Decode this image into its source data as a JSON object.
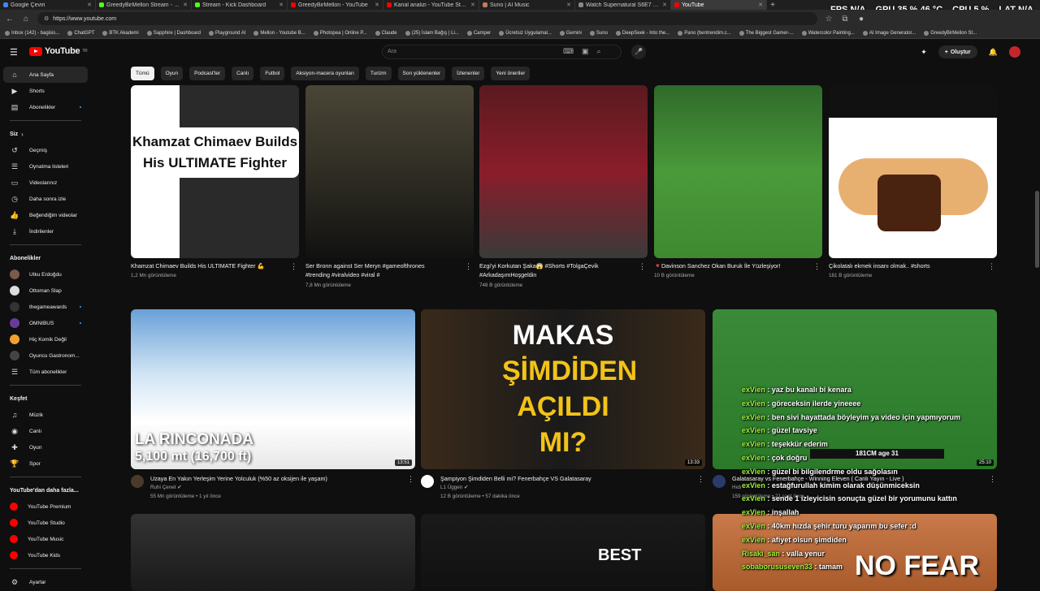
{
  "tabs": [
    {
      "label": "Google Çeviri",
      "color": "#4285f4"
    },
    {
      "label": "GreedyBirMellon Stream - Watch",
      "color": "#53fc18"
    },
    {
      "label": "Stream - Kick Dashboard",
      "color": "#53fc18"
    },
    {
      "label": "GreedyBirMellon - YouTube",
      "color": "#ff0000"
    },
    {
      "label": "Kanal analizi - YouTube Studio",
      "color": "#ff0000"
    },
    {
      "label": "Suno | AI Music",
      "color": "#c47a5a"
    },
    {
      "label": "Watch Supernatural S6E7 online",
      "color": "#888888"
    },
    {
      "label": "YouTube",
      "color": "#ff0000"
    }
  ],
  "overlay": {
    "fps_label": "FPS",
    "fps_value": "N/A",
    "gpu_label": "GPU",
    "gpu_value": "35 % 46 °C",
    "cpu_label": "CPU",
    "cpu_value": "5 %",
    "lat_label": "LAT",
    "lat_value": "N/A"
  },
  "address": {
    "url": "https://www.youtube.com"
  },
  "bookmarks": [
    "Inbox (142) - bagisis...",
    "ChatGPT",
    "BTK Akademi",
    "Sapphire | Dashboard",
    "Playground AI",
    "Mellon - Youtube B...",
    "Photopea | Online P...",
    "Claude",
    "(25) İslam Bağış | Li...",
    "Camper",
    "Ücretsiz Uygulamal...",
    "Gemini",
    "Suno",
    "DeepSeek - Into the...",
    "Pano (bentrendim.c...",
    "The Biggest Gamer-...",
    "Watercolor Painting...",
    "AI Image Generator...",
    "GreedyBirMellon St..."
  ],
  "header": {
    "logo": "YouTube",
    "logo_region": "TR",
    "search_placeholder": "Ara",
    "create_label": "Oluştur"
  },
  "sidebar": {
    "main": [
      {
        "label": "Ana Sayfa",
        "icon": "home-icon"
      },
      {
        "label": "Shorts",
        "icon": "shorts-icon"
      },
      {
        "label": "Abonelikler",
        "icon": "subscriptions-icon"
      }
    ],
    "you_title": "Siz",
    "you": [
      {
        "label": "Geçmiş",
        "icon": "history-icon"
      },
      {
        "label": "Oynatma listeleri",
        "icon": "playlist-icon"
      },
      {
        "label": "Videolarınız",
        "icon": "video-icon"
      },
      {
        "label": "Daha sonra izle",
        "icon": "clock-icon"
      },
      {
        "label": "Beğendiğim videolar",
        "icon": "like-icon"
      },
      {
        "label": "İndirilenler",
        "icon": "download-icon"
      }
    ],
    "subs_title": "Abonelikler",
    "subs": [
      {
        "label": "Utku Erdoğdu",
        "color": "#7a5a4a"
      },
      {
        "label": "Ottoman Slap",
        "color": "#dddddd"
      },
      {
        "label": "thegameawards",
        "color": "#333333"
      },
      {
        "label": "OMNIBUS",
        "color": "#6a3a9a"
      },
      {
        "label": "Hiç Komik Değil",
        "color": "#f0a030"
      },
      {
        "label": "Oyuncu Gastronom...",
        "color": "#444444"
      },
      {
        "label": "Tüm abonelikler",
        "color": ""
      }
    ],
    "explore_title": "Keşfet",
    "explore": [
      {
        "label": "Müzik",
        "icon": "music-icon"
      },
      {
        "label": "Canlı",
        "icon": "live-icon"
      },
      {
        "label": "Oyun",
        "icon": "gamepad-icon"
      },
      {
        "label": "Spor",
        "icon": "trophy-icon"
      }
    ],
    "more_title": "YouTube'dan daha fazla...",
    "more": [
      {
        "label": "YouTube Premium"
      },
      {
        "label": "YouTube Studio"
      },
      {
        "label": "YouTube Music"
      },
      {
        "label": "YouTube Kids"
      }
    ],
    "settings": "Ayarlar"
  },
  "chips": [
    "Tümü",
    "Oyun",
    "Podcast'ler",
    "Canlı",
    "Futbol",
    "Aksiyon-macera oyunları",
    "Turizm",
    "Son yüklenenler",
    "İzlenenler",
    "Yeni öneriler"
  ],
  "shorts": [
    {
      "title": "Khamzat Chimaev Builds His ULTIMATE Fighter 💪",
      "meta": "1,2 Mn görüntüleme",
      "overlay1": "Khamzat Chimaev Builds",
      "overlay2": "His ULTIMATE Fighter"
    },
    {
      "title": "Ser Bronn against Ser Meryn #gameofthrones",
      "title2": "#trending #viralvideo #viral #",
      "meta": "7,8 Mn görüntüleme"
    },
    {
      "title": "Ezgi'yi Korkutan Şaka😱 #Shorts #TolgaÇevik",
      "title2": "#ArkadaşımHoşgeldin",
      "meta": "748 B görüntüleme"
    },
    {
      "title": "🔻Davinson Sanchez Okan Buruk İle Yüzleşiyor!",
      "meta": "10 B görüntüleme"
    },
    {
      "title": "Çikolatalı ekmek insanı olmak.. #shorts",
      "meta": "181 B görüntüleme"
    }
  ],
  "videos": [
    {
      "title": "Uzaya En Yakın Yerleşim Yerine Yolculuk (%50 az oksijen ile yaşam)",
      "channel": "Ruhi Çenet ✔",
      "meta": "55 Mn görüntüleme • 1 yıl önce",
      "duration": "13:51",
      "thumb_line1": "LA RINCONADA",
      "thumb_line2": "5,100 mt (16,700 ft)"
    },
    {
      "title": "Şampiyon Şimdiden Belli mi? Fenerbahçe VS Galatasaray",
      "channel": "L1 Üggen ✔",
      "meta": "12 B görüntüleme • 57 dakika önce",
      "duration": "13:33",
      "thumb_line1": "MAKAS",
      "thumb_line2": "ŞİMDİDEN",
      "thumb_line3": "AÇILDI MI?"
    },
    {
      "title": "Galatasaray vs Fenerbahçe - Winning Eleven ( Canlı Yayın - Live )",
      "channel": "Hıdı",
      "meta": "159 görüntüleme • 21 saat önce",
      "duration": "25:10",
      "score": "181CM age 31"
    }
  ],
  "row3": [
    {
      "thumb_text": ""
    },
    {
      "thumb_text": "BEST"
    },
    {
      "thumb_text": "NO FEAR"
    }
  ],
  "chat": [
    {
      "u": "exVien",
      "m": "yaz bu kanalı bi kenara"
    },
    {
      "u": "exVien",
      "m": "göreceksin ilerde yineeee"
    },
    {
      "u": "exVien",
      "m": "ben sivi hayattada böyleyim ya video için yapmıyorum"
    },
    {
      "u": "exVien",
      "m": "güzel tavsiye"
    },
    {
      "u": "exVien",
      "m": "teşekkür ederim"
    },
    {
      "u": "exVien",
      "m": "çok doğru"
    },
    {
      "u": "exVien",
      "m": "güzel bi bilgilendrme oldu sağolasın"
    },
    {
      "u": "exVien",
      "m": "estağfurullah kimim olarak düşünmiceksin"
    },
    {
      "u": "exVien",
      "m": "sende 1 izleyicisin sonuçta güzel bir yorumunu kattın"
    },
    {
      "u": "exVien",
      "m": "inşallah"
    },
    {
      "u": "exVien",
      "m": "40km hızda şehir turu yaparım bu sefer :d"
    },
    {
      "u": "exVien",
      "m": "afiyet olsun şimdiden"
    },
    {
      "u": "Risaki_san",
      "m": "valla yenur"
    },
    {
      "u": "sobaborususeven33",
      "m": "tamam"
    }
  ],
  "colors": {
    "accent": "#ff0000",
    "chat_user": "#9ff23b",
    "bg": "#0f0f0f"
  }
}
